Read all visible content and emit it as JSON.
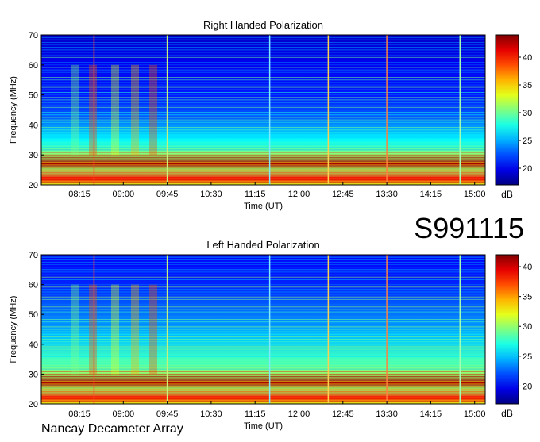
{
  "page": {
    "observation_id": "S991115",
    "instrument": "Nancay Decameter Array"
  },
  "chart_data": [
    {
      "type": "heatmap",
      "title": "Right Handed Polarization",
      "xlabel": "Time (UT)",
      "ylabel": "Frequency (MHz)",
      "xticks": [
        "08:15",
        "09:00",
        "09:45",
        "10:30",
        "11:15",
        "12:00",
        "12:45",
        "13:30",
        "14:15",
        "15:00"
      ],
      "yticks": [
        20,
        30,
        40,
        50,
        60,
        70
      ],
      "ylim": [
        20,
        70
      ],
      "colorbar": {
        "label": "dB",
        "ticks": [
          20,
          25,
          30,
          35,
          40
        ],
        "range": [
          17,
          44
        ]
      },
      "bands_db": [
        {
          "f": 70,
          "db": 19
        },
        {
          "f": 60,
          "db": 20
        },
        {
          "f": 50,
          "db": 21
        },
        {
          "f": 42,
          "db": 23
        },
        {
          "f": 35,
          "db": 27
        },
        {
          "f": 30,
          "db": 31
        },
        {
          "f": 27,
          "db": 43
        },
        {
          "f": 25,
          "db": 31
        },
        {
          "f": 22,
          "db": 40
        },
        {
          "f": 20,
          "db": 33
        }
      ],
      "vertical_lines_ut": [
        {
          "time": "08:30",
          "color": "#ff4a2a"
        },
        {
          "time": "09:45",
          "color": "#c8f07a"
        },
        {
          "time": "11:30",
          "color": "#7fe8ff"
        },
        {
          "time": "12:30",
          "color": "#ffcf50"
        },
        {
          "time": "13:30",
          "color": "#ff8040"
        },
        {
          "time": "14:45",
          "color": "#a4ffb0"
        }
      ]
    },
    {
      "type": "heatmap",
      "title": "Left Handed Polarization",
      "xlabel": "Time (UT)",
      "ylabel": "Frequency (MHz)",
      "xticks": [
        "08:15",
        "09:00",
        "09:45",
        "10:30",
        "11:15",
        "12:00",
        "12:45",
        "13:30",
        "14:15",
        "15:00"
      ],
      "yticks": [
        20,
        30,
        40,
        50,
        60,
        70
      ],
      "ylim": [
        20,
        70
      ],
      "colorbar": {
        "label": "dB",
        "ticks": [
          20,
          25,
          30,
          35,
          40
        ],
        "range": [
          17,
          42
        ]
      },
      "bands_db": [
        {
          "f": 70,
          "db": 20
        },
        {
          "f": 60,
          "db": 21
        },
        {
          "f": 50,
          "db": 23
        },
        {
          "f": 42,
          "db": 25
        },
        {
          "f": 35,
          "db": 28
        },
        {
          "f": 30,
          "db": 30
        },
        {
          "f": 27,
          "db": 41
        },
        {
          "f": 25,
          "db": 30
        },
        {
          "f": 22,
          "db": 38
        },
        {
          "f": 20,
          "db": 32
        }
      ],
      "vertical_lines_ut": [
        {
          "time": "08:30",
          "color": "#ff4a2a"
        },
        {
          "time": "09:45",
          "color": "#c8f07a"
        },
        {
          "time": "11:30",
          "color": "#7fe8ff"
        },
        {
          "time": "12:30",
          "color": "#ffcf50"
        },
        {
          "time": "13:30",
          "color": "#ff8040"
        },
        {
          "time": "14:45",
          "color": "#a4ffb0"
        }
      ]
    }
  ]
}
